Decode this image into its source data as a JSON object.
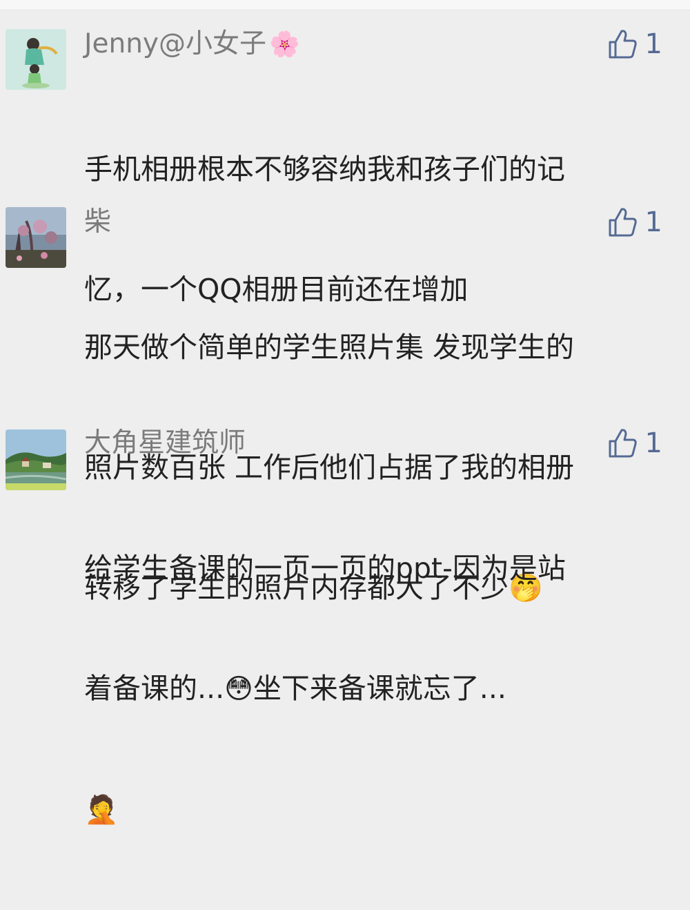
{
  "comments": [
    {
      "author": "Jenny@小女子",
      "author_emoji": "🌸",
      "likes": "1",
      "lines": [
        "手机相册根本不够容纳我和孩子们的记",
        "忆，一个QQ相册目前还在增加"
      ]
    },
    {
      "author": "柴",
      "likes": "1",
      "lines": [
        "那天做个简单的学生照片集 发现学生的",
        "照片数百张 工作后他们占据了我的相册",
        "转移了学生的照片内存都大了不少"
      ],
      "tail_emoji": "🤭"
    },
    {
      "author": "大角星建筑师",
      "likes": "1",
      "line1": "给学生备课的一页一页的ppt-因为是站",
      "line2_a": "着备课的...",
      "line2_emoji": "😳",
      "line2_b": "坐下来备课就忘了...",
      "line3_emoji": "🤦"
    }
  ],
  "colors": {
    "author": "#7b7b7b",
    "like": "#556a93",
    "text": "#222222",
    "background": "#eeeeee"
  }
}
